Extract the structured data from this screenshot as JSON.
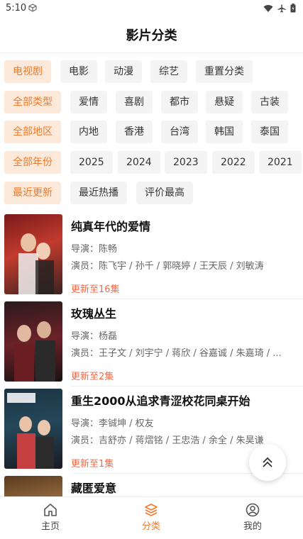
{
  "status": {
    "time": "5:10"
  },
  "page_title": "影片分类",
  "filters": {
    "type_row": [
      {
        "label": "电视剧",
        "active": true
      },
      {
        "label": "电影",
        "active": false
      },
      {
        "label": "动漫",
        "active": false
      },
      {
        "label": "综艺",
        "active": false
      },
      {
        "label": "重置分类",
        "active": false
      }
    ],
    "genre_row": [
      {
        "label": "全部类型",
        "active": true
      },
      {
        "label": "爱情",
        "active": false
      },
      {
        "label": "喜剧",
        "active": false
      },
      {
        "label": "都市",
        "active": false
      },
      {
        "label": "悬疑",
        "active": false
      },
      {
        "label": "古装",
        "active": false
      }
    ],
    "region_row": [
      {
        "label": "全部地区",
        "active": true
      },
      {
        "label": "内地",
        "active": false
      },
      {
        "label": "香港",
        "active": false
      },
      {
        "label": "台湾",
        "active": false
      },
      {
        "label": "韩国",
        "active": false
      },
      {
        "label": "泰国",
        "active": false
      }
    ],
    "year_row": [
      {
        "label": "全部年份",
        "active": true
      },
      {
        "label": "2025",
        "active": false
      },
      {
        "label": "2024",
        "active": false
      },
      {
        "label": "2023",
        "active": false
      },
      {
        "label": "2022",
        "active": false
      },
      {
        "label": "2021",
        "active": false
      }
    ],
    "sort_row": [
      {
        "label": "最近更新",
        "active": true
      },
      {
        "label": "最近热播",
        "active": false
      },
      {
        "label": "评价最高",
        "active": false
      }
    ]
  },
  "items": [
    {
      "title": "纯真年代的爱情",
      "director": "导演：陈畅",
      "cast": "演员：陈飞宇 / 孙千 / 郭晓婷 / 王天辰 / 刘敏涛",
      "update": "更新至16集"
    },
    {
      "title": "玫瑰丛生",
      "director": "导演：杨磊",
      "cast": "演员：王子文 / 刘宇宁 / 蒋欣 / 谷嘉诚 / 朱嘉琦 / ...",
      "update": "更新至2集"
    },
    {
      "title": "重生2000从追求青涩校花同桌开始",
      "director": "导演：李铖坤 / 权友",
      "cast": "演员：吉舒亦 / 蒋熠铭 / 王忠浩 / 余全 / 朱昊谦",
      "update": "更新至1集"
    },
    {
      "title": "藏匿爱意",
      "director": "",
      "cast": "",
      "update": ""
    }
  ],
  "nav": {
    "home": "主页",
    "category": "分类",
    "mine": "我的"
  },
  "colors": {
    "accent": "#f07a2a",
    "update_red": "#f06a4a",
    "chip_bg": "#f4f4f4",
    "chip_active_bg": "#fde9d9"
  }
}
